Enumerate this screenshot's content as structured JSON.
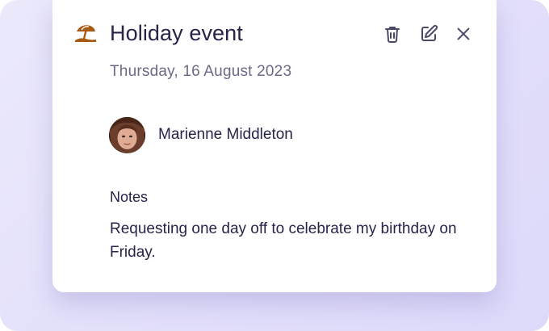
{
  "event": {
    "title": "Holiday event",
    "date": "Thursday, 16 August 2023",
    "type_icon": "beach-umbrella-icon"
  },
  "actions": {
    "delete_icon": "trash-icon",
    "edit_icon": "edit-icon",
    "close_icon": "close-icon"
  },
  "person": {
    "name": "Marienne Middleton"
  },
  "notes": {
    "label": "Notes",
    "text": "Requesting one day off to celebrate my birthday on Friday."
  },
  "colors": {
    "text_primary": "#27244a",
    "text_secondary": "#6c6a86",
    "icon_accent": "#a85a12",
    "backdrop": "#e3e0fb"
  }
}
